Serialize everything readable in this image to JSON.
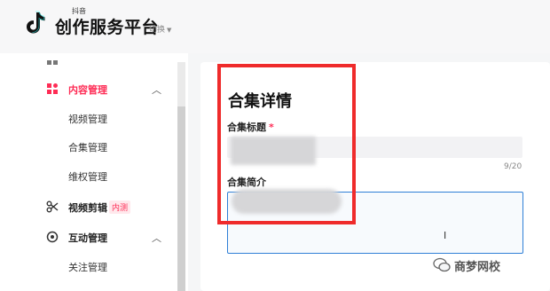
{
  "header": {
    "brand_small": "抖音",
    "brand": "创作服务平台",
    "switch_label": "切换"
  },
  "sidebar": {
    "items": [
      {
        "label": "内容管理",
        "active": true
      },
      {
        "label": "视频剪辑",
        "badge": "内测"
      },
      {
        "label": "互动管理"
      }
    ],
    "content_sub": [
      "视频管理",
      "合集管理",
      "维权管理"
    ],
    "interact_sub": [
      "关注管理"
    ]
  },
  "main": {
    "title": "合集详情",
    "title_field_label": "合集标题",
    "required_mark": "*",
    "title_counter": "9/20",
    "desc_field_label": "合集简介"
  },
  "watermark": {
    "text": "商梦网校"
  },
  "colors": {
    "accent": "#fe2c55",
    "annotation": "#ef2b2b",
    "focus_border": "#2f7fd6"
  }
}
